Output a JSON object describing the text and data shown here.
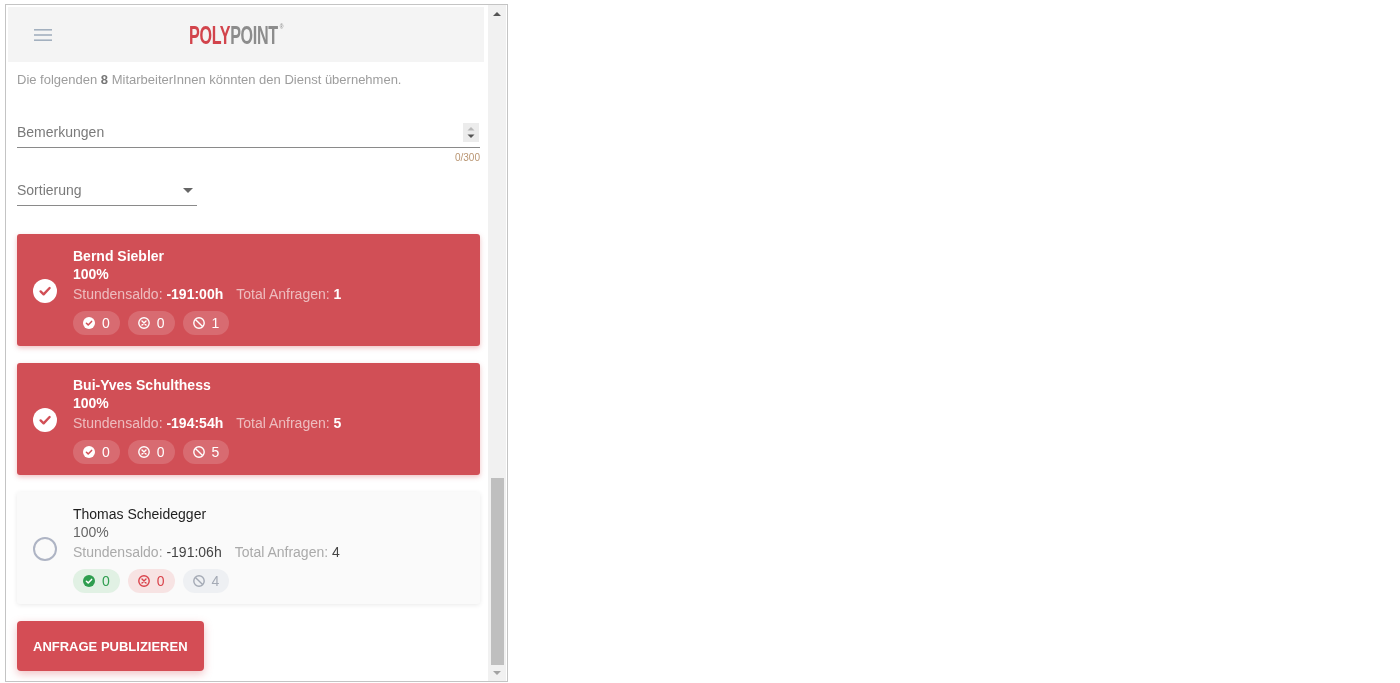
{
  "header": {
    "logo": {
      "part_1": "POLY",
      "part_2": "POINT",
      "mark": "®"
    }
  },
  "intro": "Die folgenden **8** MitarbeiterInnen könnten den Dienst übernehmen.",
  "remarks": {
    "placeholder": "Bemerkungen",
    "counter": "0/300"
  },
  "sort": {
    "placeholder": "Sortierung"
  },
  "employees": [
    {
      "name": "Bernd Siebler",
      "percent": "100%",
      "balance_label": "Stundensaldo:",
      "balance": "-191:00h",
      "requests_label": "Total Anfragen:",
      "requests": "1",
      "selected": true,
      "counts": [
        {
          "kind": "accepted",
          "value": "0"
        },
        {
          "kind": "declined",
          "value": "0"
        },
        {
          "kind": "blocked",
          "value": "1"
        }
      ]
    },
    {
      "name": "Bui-Yves Schulthess",
      "percent": "100%",
      "balance_label": "Stundensaldo:",
      "balance": "-194:54h",
      "requests_label": "Total Anfragen:",
      "requests": "5",
      "selected": true,
      "counts": [
        {
          "kind": "accepted",
          "value": "0"
        },
        {
          "kind": "declined",
          "value": "0"
        },
        {
          "kind": "blocked",
          "value": "5"
        }
      ]
    },
    {
      "name": "Thomas Scheidegger",
      "percent": "100%",
      "balance_label": "Stundensaldo:",
      "balance": "-191:06h",
      "requests_label": "Total Anfragen:",
      "requests": "4",
      "selected": false,
      "counts": [
        {
          "kind": "accepted",
          "value": "0"
        },
        {
          "kind": "declined",
          "value": "0"
        },
        {
          "kind": "blocked",
          "value": "4"
        }
      ]
    }
  ],
  "publish_button": "ANFRAGE PUBLIZIEREN"
}
